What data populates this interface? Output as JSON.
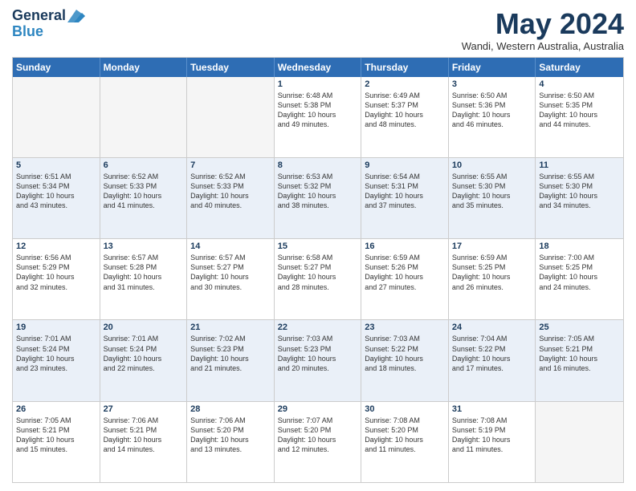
{
  "header": {
    "logo_line1": "General",
    "logo_line2": "Blue",
    "month_title": "May 2024",
    "location": "Wandi, Western Australia, Australia"
  },
  "day_headers": [
    "Sunday",
    "Monday",
    "Tuesday",
    "Wednesday",
    "Thursday",
    "Friday",
    "Saturday"
  ],
  "weeks": [
    [
      {
        "num": "",
        "info": ""
      },
      {
        "num": "",
        "info": ""
      },
      {
        "num": "",
        "info": ""
      },
      {
        "num": "1",
        "info": "Sunrise: 6:48 AM\nSunset: 5:38 PM\nDaylight: 10 hours\nand 49 minutes."
      },
      {
        "num": "2",
        "info": "Sunrise: 6:49 AM\nSunset: 5:37 PM\nDaylight: 10 hours\nand 48 minutes."
      },
      {
        "num": "3",
        "info": "Sunrise: 6:50 AM\nSunset: 5:36 PM\nDaylight: 10 hours\nand 46 minutes."
      },
      {
        "num": "4",
        "info": "Sunrise: 6:50 AM\nSunset: 5:35 PM\nDaylight: 10 hours\nand 44 minutes."
      }
    ],
    [
      {
        "num": "5",
        "info": "Sunrise: 6:51 AM\nSunset: 5:34 PM\nDaylight: 10 hours\nand 43 minutes."
      },
      {
        "num": "6",
        "info": "Sunrise: 6:52 AM\nSunset: 5:33 PM\nDaylight: 10 hours\nand 41 minutes."
      },
      {
        "num": "7",
        "info": "Sunrise: 6:52 AM\nSunset: 5:33 PM\nDaylight: 10 hours\nand 40 minutes."
      },
      {
        "num": "8",
        "info": "Sunrise: 6:53 AM\nSunset: 5:32 PM\nDaylight: 10 hours\nand 38 minutes."
      },
      {
        "num": "9",
        "info": "Sunrise: 6:54 AM\nSunset: 5:31 PM\nDaylight: 10 hours\nand 37 minutes."
      },
      {
        "num": "10",
        "info": "Sunrise: 6:55 AM\nSunset: 5:30 PM\nDaylight: 10 hours\nand 35 minutes."
      },
      {
        "num": "11",
        "info": "Sunrise: 6:55 AM\nSunset: 5:30 PM\nDaylight: 10 hours\nand 34 minutes."
      }
    ],
    [
      {
        "num": "12",
        "info": "Sunrise: 6:56 AM\nSunset: 5:29 PM\nDaylight: 10 hours\nand 32 minutes."
      },
      {
        "num": "13",
        "info": "Sunrise: 6:57 AM\nSunset: 5:28 PM\nDaylight: 10 hours\nand 31 minutes."
      },
      {
        "num": "14",
        "info": "Sunrise: 6:57 AM\nSunset: 5:27 PM\nDaylight: 10 hours\nand 30 minutes."
      },
      {
        "num": "15",
        "info": "Sunrise: 6:58 AM\nSunset: 5:27 PM\nDaylight: 10 hours\nand 28 minutes."
      },
      {
        "num": "16",
        "info": "Sunrise: 6:59 AM\nSunset: 5:26 PM\nDaylight: 10 hours\nand 27 minutes."
      },
      {
        "num": "17",
        "info": "Sunrise: 6:59 AM\nSunset: 5:25 PM\nDaylight: 10 hours\nand 26 minutes."
      },
      {
        "num": "18",
        "info": "Sunrise: 7:00 AM\nSunset: 5:25 PM\nDaylight: 10 hours\nand 24 minutes."
      }
    ],
    [
      {
        "num": "19",
        "info": "Sunrise: 7:01 AM\nSunset: 5:24 PM\nDaylight: 10 hours\nand 23 minutes."
      },
      {
        "num": "20",
        "info": "Sunrise: 7:01 AM\nSunset: 5:24 PM\nDaylight: 10 hours\nand 22 minutes."
      },
      {
        "num": "21",
        "info": "Sunrise: 7:02 AM\nSunset: 5:23 PM\nDaylight: 10 hours\nand 21 minutes."
      },
      {
        "num": "22",
        "info": "Sunrise: 7:03 AM\nSunset: 5:23 PM\nDaylight: 10 hours\nand 20 minutes."
      },
      {
        "num": "23",
        "info": "Sunrise: 7:03 AM\nSunset: 5:22 PM\nDaylight: 10 hours\nand 18 minutes."
      },
      {
        "num": "24",
        "info": "Sunrise: 7:04 AM\nSunset: 5:22 PM\nDaylight: 10 hours\nand 17 minutes."
      },
      {
        "num": "25",
        "info": "Sunrise: 7:05 AM\nSunset: 5:21 PM\nDaylight: 10 hours\nand 16 minutes."
      }
    ],
    [
      {
        "num": "26",
        "info": "Sunrise: 7:05 AM\nSunset: 5:21 PM\nDaylight: 10 hours\nand 15 minutes."
      },
      {
        "num": "27",
        "info": "Sunrise: 7:06 AM\nSunset: 5:21 PM\nDaylight: 10 hours\nand 14 minutes."
      },
      {
        "num": "28",
        "info": "Sunrise: 7:06 AM\nSunset: 5:20 PM\nDaylight: 10 hours\nand 13 minutes."
      },
      {
        "num": "29",
        "info": "Sunrise: 7:07 AM\nSunset: 5:20 PM\nDaylight: 10 hours\nand 12 minutes."
      },
      {
        "num": "30",
        "info": "Sunrise: 7:08 AM\nSunset: 5:20 PM\nDaylight: 10 hours\nand 11 minutes."
      },
      {
        "num": "31",
        "info": "Sunrise: 7:08 AM\nSunset: 5:19 PM\nDaylight: 10 hours\nand 11 minutes."
      },
      {
        "num": "",
        "info": ""
      }
    ]
  ]
}
